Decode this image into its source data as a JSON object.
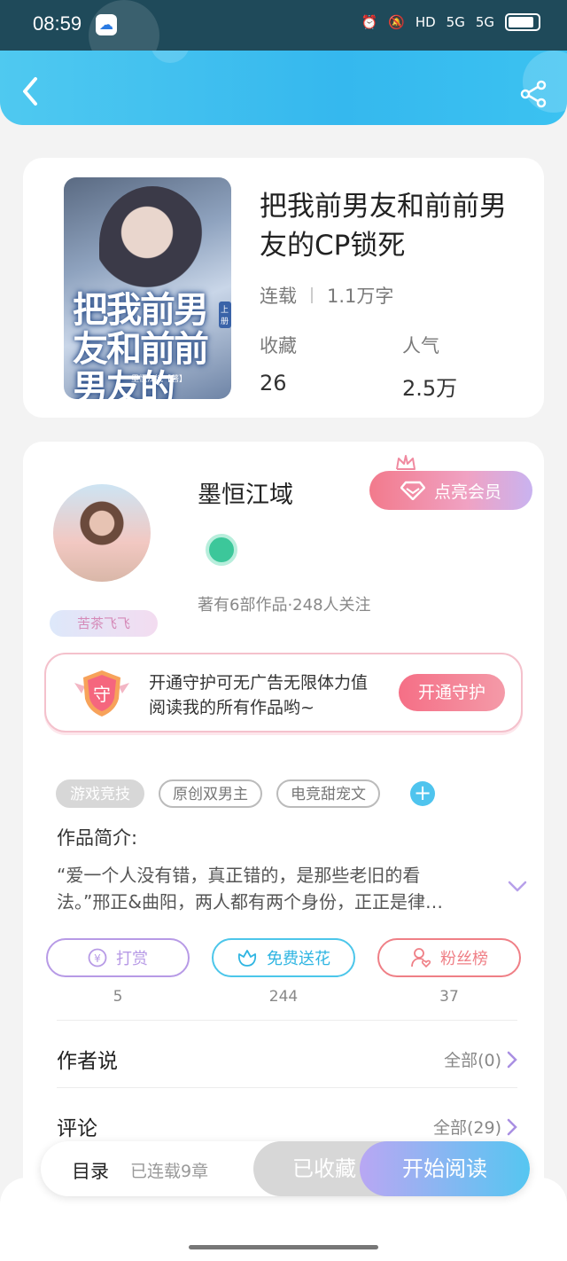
{
  "status_bar": {
    "time": "08:59",
    "hd": "HD",
    "net1": "5G",
    "net2": "5G"
  },
  "book": {
    "title": "把我前男友和前前男友的CP锁死",
    "status": "连载",
    "word_count": "1.1万字",
    "fav_label": "收藏",
    "fav_count": "26",
    "popularity_label": "人气",
    "popularity_count": "2.5万",
    "cover_art_title": "把我前男友和前前男友的",
    "cover_tag": "上册",
    "cover_author": "墨恒江域【著】"
  },
  "author": {
    "name": "墨恒江域",
    "vip_button": "点亮会员",
    "stats": "著有6部作品·248人关注",
    "badge_name": "苦茶飞飞"
  },
  "guard": {
    "icon_char": "守",
    "text": "开通守护可无广告无限体力值阅读我的所有作品哟~",
    "button": "开通守护"
  },
  "tags": [
    "游戏竞技",
    "原创双男主",
    "电竞甜宠文"
  ],
  "add_tag_symbol": "+",
  "intro": {
    "label": "作品简介:",
    "text": "“爱一个人没有错，真正错的，是那些老旧的看法。”邢正&曲阳，两人都有两个身份，正正是律…"
  },
  "actions": [
    {
      "label": "打赏",
      "count": "5",
      "color": "#b79ae6"
    },
    {
      "label": "免费送花",
      "count": "244",
      "color": "#4cc6ea"
    },
    {
      "label": "粉丝榜",
      "count": "37",
      "color": "#ef7f86"
    }
  ],
  "author_says": {
    "label": "作者说",
    "right": "全部(0)"
  },
  "comments": {
    "label": "评论",
    "right": "全部(29)"
  },
  "bottom_bar": {
    "toc": "目录",
    "serial": "已连载9章",
    "favorited": "已收藏",
    "start_reading": "开始阅读"
  }
}
